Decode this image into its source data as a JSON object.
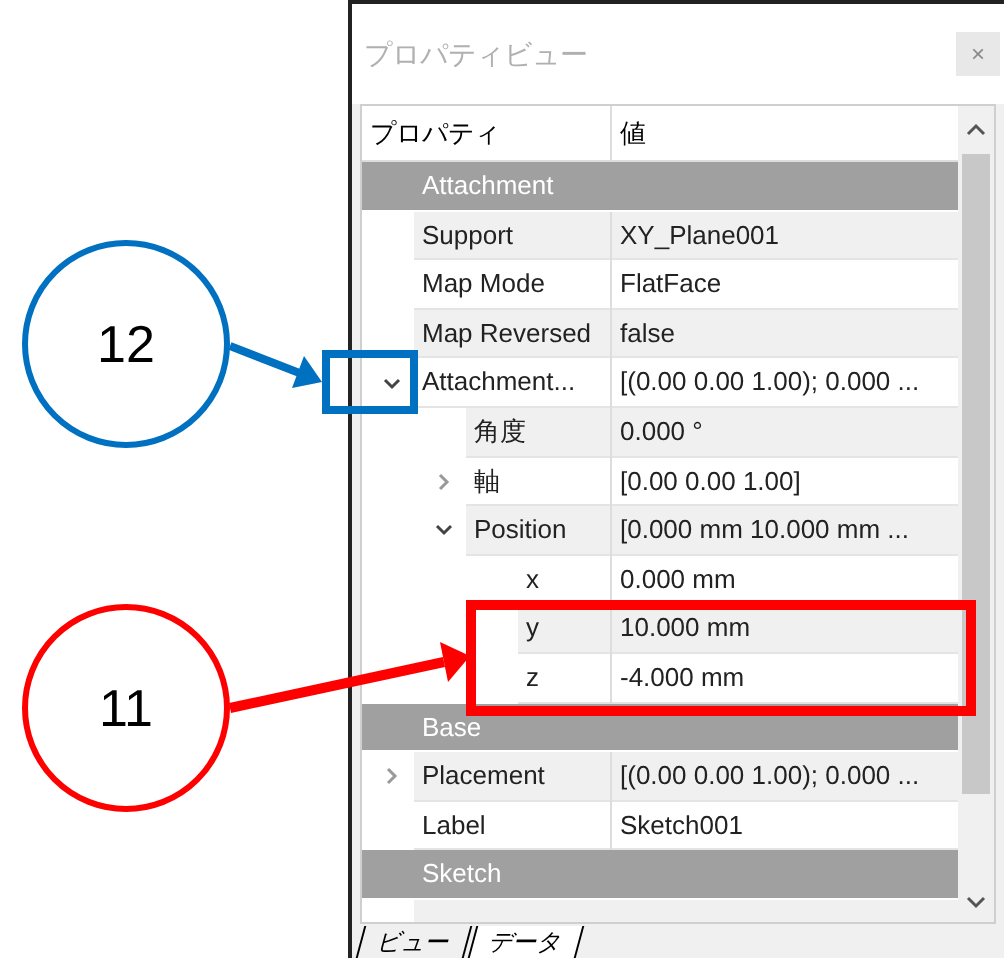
{
  "panel": {
    "title": "プロパティビュー",
    "close": "×"
  },
  "table": {
    "columns": [
      "プロパティ",
      "値"
    ],
    "groups": [
      {
        "name": "Attachment",
        "properties": [
          {
            "name": "Support",
            "value": "XY_Plane001"
          },
          {
            "name": "Map Mode",
            "value": "FlatFace"
          },
          {
            "name": "Map Reversed",
            "value": "false"
          },
          {
            "name": "Attachment...",
            "value": "[(0.00 0.00 1.00); 0.000 ...",
            "expanded": true,
            "children": [
              {
                "name": "角度",
                "value": "0.000 °"
              },
              {
                "name": "軸",
                "value": "[0.00 0.00 1.00]",
                "expanded": false
              },
              {
                "name": "Position",
                "value": "[0.000 mm  10.000 mm ...",
                "expanded": true,
                "children": [
                  {
                    "name": "x",
                    "value": "0.000 mm"
                  },
                  {
                    "name": "y",
                    "value": "10.000 mm"
                  },
                  {
                    "name": "z",
                    "value": "-4.000 mm"
                  }
                ]
              }
            ]
          }
        ]
      },
      {
        "name": "Base",
        "properties": [
          {
            "name": "Placement",
            "value": "[(0.00 0.00 1.00); 0.000 ...",
            "expanded": false
          },
          {
            "name": "Label",
            "value": "Sketch001"
          }
        ]
      },
      {
        "name": "Sketch"
      }
    ]
  },
  "tabs": [
    {
      "label": "ビュー",
      "selected": false
    },
    {
      "label": "データ",
      "selected": true
    }
  ],
  "annotations": [
    {
      "label": "12",
      "color": "#0070c0"
    },
    {
      "label": "11",
      "color": "#ff0000"
    }
  ]
}
